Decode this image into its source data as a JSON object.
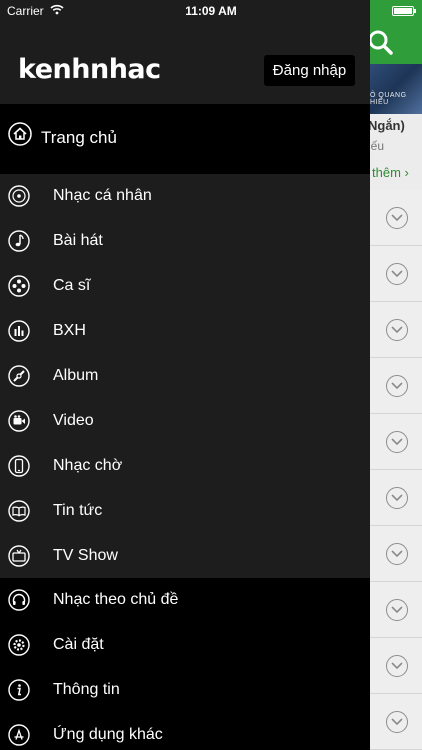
{
  "status_bar": {
    "carrier": "Carrier",
    "time": "11:09 AM"
  },
  "drawer": {
    "logo": "kenhnhac",
    "login_button": "Đăng nhập",
    "home_label": "Trang chủ",
    "items": [
      {
        "label": "Nhạc cá nhân",
        "icon": "personal-music-icon"
      },
      {
        "label": "Bài hát",
        "icon": "music-note-icon"
      },
      {
        "label": "Ca sĩ",
        "icon": "film-reel-icon"
      },
      {
        "label": "BXH",
        "icon": "chart-icon"
      },
      {
        "label": "Album",
        "icon": "album-icon"
      },
      {
        "label": "Video",
        "icon": "video-camera-icon"
      },
      {
        "label": "Nhạc chờ",
        "icon": "phone-icon"
      },
      {
        "label": "Tin tức",
        "icon": "book-icon"
      },
      {
        "label": "TV Show",
        "icon": "tv-icon"
      },
      {
        "label": "Nhạc theo chủ đề",
        "icon": "headphones-icon"
      },
      {
        "label": "Cài đặt",
        "icon": "settings-icon"
      },
      {
        "label": "Thông tin",
        "icon": "info-icon"
      },
      {
        "label": "Ứng dụng khác",
        "icon": "app-store-icon"
      }
    ]
  },
  "background": {
    "title": "Ngắn)",
    "subtitle": "iếu",
    "more_link": "thêm",
    "banner_text": "Ô QUANG HIẾU"
  },
  "colors": {
    "accent_green": "#2f9e3a",
    "drawer_bg": "#1d1d1d"
  }
}
